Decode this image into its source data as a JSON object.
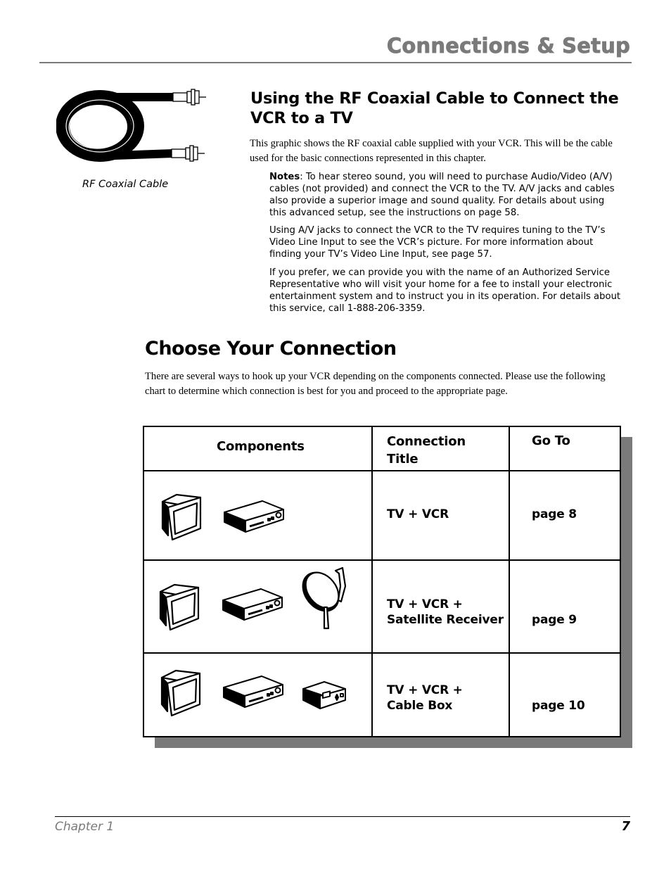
{
  "header": {
    "title": "Connections & Setup"
  },
  "cable_figure": {
    "icon": "coaxial-cable-icon",
    "caption": "RF Coaxial Cable"
  },
  "section_rf": {
    "heading": "Using the RF Coaxial Cable to Connect the VCR to a TV",
    "intro": "This graphic shows the RF coaxial cable supplied with your VCR. This will be the cable used for the basic connections represented in this chapter.",
    "notes": [
      {
        "label": "Notes",
        "text": ": To hear stereo sound, you will need to purchase Audio/Video (A/V) cables (not provided) and connect the VCR to the TV. A/V jacks and cables also provide a superior image and sound quality. For details about using this advanced setup, see the instructions on page 58."
      },
      {
        "text": "Using A/V jacks to connect the VCR to the TV requires tuning to the TV’s Video Line Input to see the VCR’s picture. For more information about finding your TV’s Video Line Input, see page 57."
      },
      {
        "text": "If you prefer, we can provide you with the name of an Authorized Service Representative who will visit your home for a fee to install your electronic entertainment system and to instruct you in its operation. For details about this service, call 1-888-206-3359."
      }
    ]
  },
  "section_choose": {
    "heading": "Choose Your Connection",
    "intro": "There are several ways to hook up your VCR depending on the components connected. Please use the following chart to determine which connection is best for you and proceed to the appropriate page."
  },
  "table": {
    "headers": {
      "components": "Components",
      "connection_title_line1": "Connection",
      "connection_title_line2": "Title",
      "go_to": "Go To"
    },
    "rows": [
      {
        "components": [
          "tv-icon",
          "vcr-icon"
        ],
        "title_line1": "TV + VCR",
        "title_line2": "",
        "go_to": "page 8"
      },
      {
        "components": [
          "tv-icon",
          "vcr-icon",
          "satellite-dish-icon"
        ],
        "title_line1": "TV + VCR +",
        "title_line2": "Satellite Receiver",
        "go_to": "page 9"
      },
      {
        "components": [
          "tv-icon",
          "vcr-icon",
          "cable-box-icon"
        ],
        "title_line1": "TV + VCR +",
        "title_line2": "Cable Box",
        "go_to": "page 10"
      }
    ]
  },
  "footer": {
    "chapter": "Chapter 1",
    "page_number": "7"
  }
}
